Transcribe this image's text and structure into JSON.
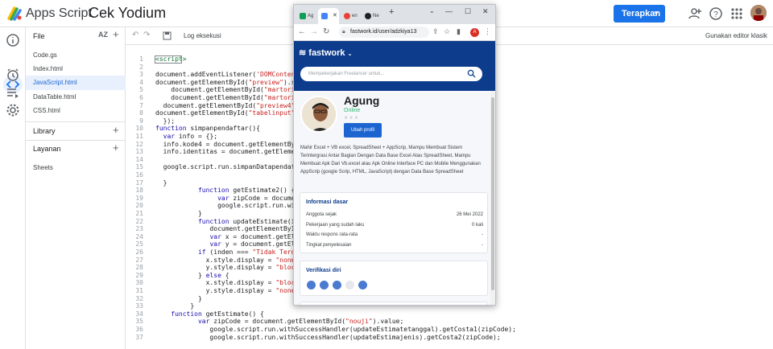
{
  "app": {
    "title": "Apps Script",
    "project_name": "Cek Yodium",
    "deploy_label": "Terapkan",
    "classic_editor": "Gunakan editor klasik"
  },
  "files": {
    "header": "File",
    "sort_label": "AZ",
    "items": [
      "Code.gs",
      "Index.html",
      "JavaScript.html",
      "DataTable.html",
      "CSS.html"
    ],
    "active_index": 2,
    "libraries": "Library",
    "services": "Layanan",
    "sheets": "Sheets"
  },
  "toolbar": {
    "log_label": "Log eksekusi"
  },
  "editor": {
    "lines": [
      {
        "n": "1",
        "t": "<script>"
      },
      {
        "n": "2",
        "t": ""
      },
      {
        "n": "3",
        "t": "document.addEventListener('DOMContentLoa"
      },
      {
        "n": "4",
        "t": "document.getElementById(\"preview\").style"
      },
      {
        "n": "5",
        "t": "    document.getElementById(\"martoriusSe"
      },
      {
        "n": "6",
        "t": "    document.getElementById(\"martoriusSe"
      },
      {
        "n": "7",
        "t": "  document.getElementById(\"preview4\").styl"
      },
      {
        "n": "8",
        "t": "document.getElementById(\"tabelinput\").st"
      },
      {
        "n": "9",
        "t": "  });"
      },
      {
        "n": "10",
        "t": "function simpanpendaftar(){"
      },
      {
        "n": "11",
        "t": "  var info = {};"
      },
      {
        "n": "12",
        "t": "  info.kode4 = document.getElementById("
      },
      {
        "n": "13",
        "t": "  info.identitas = document.getElementBy"
      },
      {
        "n": "14",
        "t": ""
      },
      {
        "n": "15",
        "t": "  google.script.run.simpanDatapendaftar("
      },
      {
        "n": "16",
        "t": ""
      },
      {
        "n": "17",
        "t": "  }"
      },
      {
        "n": "18",
        "t": "           function getEstimate2() {"
      },
      {
        "n": "19",
        "t": "                var zipCode = document.ge"
      },
      {
        "n": "20",
        "t": "                google.script.run.withSu"
      },
      {
        "n": "21",
        "t": "           }"
      },
      {
        "n": "22",
        "t": "           function updateEstimate(inde"
      },
      {
        "n": "23",
        "t": "              document.getElementById("
      },
      {
        "n": "24",
        "t": "              var x = document.getEleme"
      },
      {
        "n": "25",
        "t": "              var y = document.getEleme"
      },
      {
        "n": "26",
        "t": "           if (inden === \"Tidak Terdaft"
      },
      {
        "n": "27",
        "t": "             x.style.display = \"none\";"
      },
      {
        "n": "28",
        "t": "             y.style.display = \"block\";"
      },
      {
        "n": "29",
        "t": "           } else {"
      },
      {
        "n": "30",
        "t": "             x.style.display = \"block\";"
      },
      {
        "n": "31",
        "t": "             y.style.display = \"none\";"
      },
      {
        "n": "32",
        "t": "           }"
      },
      {
        "n": "33",
        "t": "         }"
      },
      {
        "n": "34",
        "t": "    function getEstimate() {"
      },
      {
        "n": "35",
        "t": "           var zipCode = document.getElementById(\"nouji\").value;"
      },
      {
        "n": "36",
        "t": "              google.script.run.withSuccessHandler(updateEstimatetanggal).getCosta1(zipCode);"
      },
      {
        "n": "37",
        "t": "              google.script.run.withSuccessHandler(updateEstimajenis).getCosta2(zipCode);"
      }
    ]
  },
  "browser": {
    "tabs": [
      "Ag",
      "",
      "en",
      "Ne"
    ],
    "new_tab": "+",
    "url": "fastwork.id/user/adzkiya13",
    "profile_letter": "A",
    "site_logo": "fastwork",
    "search_placeholder": "Mempekerjakan Freelancer untuk...",
    "profile": {
      "name": "Agung",
      "status": "Online",
      "edit_button": "Ubah profil",
      "bio": "Mahir Excel + VB excel, SpreadSheet + AppScrip, Mampu Membuat Sistem Terintergrasi Antar Bagian Dengan Data Base Excel Atau SpreadSheet, Mampu Membuat Apk Dari Vb.excel atau Apk Online Interface PC dan Mobile Menggunakan AppScrip (google Scrip, HTML, JavaScript) dengan Data Base SpreadSheet"
    },
    "basic_info": {
      "title": "Informasi dasar",
      "rows": [
        {
          "label": "Anggota sejak",
          "value": "26 Mei 2022"
        },
        {
          "label": "Pekerjaan yang sudah laku",
          "value": "0 kali"
        },
        {
          "label": "Waktu respons rata-rata",
          "value": "-"
        },
        {
          "label": "Tingkat penyelesaian",
          "value": "-"
        }
      ]
    },
    "verification": {
      "title": "Verifikasi diri"
    }
  },
  "colors": {
    "brand_blue": "#1a73e8",
    "fastwork_navy": "#0d3c8c",
    "online_green": "#2eb872"
  }
}
